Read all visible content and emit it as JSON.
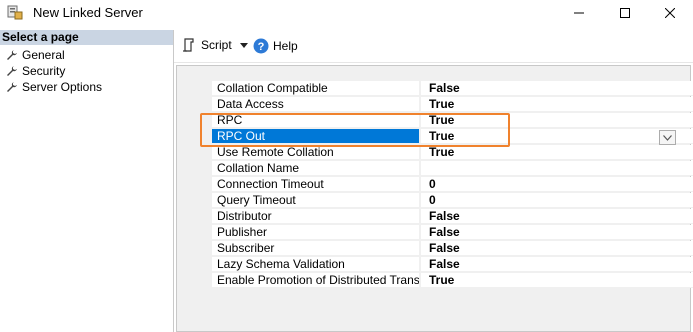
{
  "window": {
    "title": "New Linked Server",
    "icon": "linked-server-icon"
  },
  "left_pane": {
    "header": "Select a page",
    "items": [
      {
        "label": "General",
        "icon": "wrench-icon"
      },
      {
        "label": "Security",
        "icon": "wrench-icon"
      },
      {
        "label": "Server Options",
        "icon": "wrench-icon"
      }
    ]
  },
  "toolbar": {
    "script_label": "Script",
    "help_label": "Help"
  },
  "properties": [
    {
      "name": "Collation Compatible",
      "value": "False"
    },
    {
      "name": "Data Access",
      "value": "True"
    },
    {
      "name": "RPC",
      "value": "True"
    },
    {
      "name": "RPC Out",
      "value": "True",
      "selected": true
    },
    {
      "name": "Use Remote Collation",
      "value": "True"
    },
    {
      "name": "Collation Name",
      "value": ""
    },
    {
      "name": "Connection Timeout",
      "value": "0"
    },
    {
      "name": "Query Timeout",
      "value": "0"
    },
    {
      "name": "Distributor",
      "value": "False"
    },
    {
      "name": "Publisher",
      "value": "False"
    },
    {
      "name": "Subscriber",
      "value": "False"
    },
    {
      "name": "Lazy Schema Validation",
      "value": "False"
    },
    {
      "name": "Enable Promotion of Distributed Transaction",
      "value": "True"
    }
  ],
  "colors": {
    "selection": "#0078d7",
    "highlight": "#f0822d",
    "left_header": "#cad5e3"
  }
}
